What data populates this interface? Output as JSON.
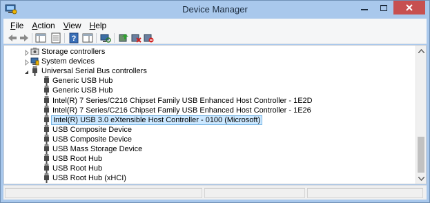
{
  "window": {
    "title": "Device Manager",
    "app_icon": "device-manager-icon"
  },
  "menu": [
    {
      "label": "File",
      "underline": "F",
      "rest": "ile"
    },
    {
      "label": "Action",
      "underline": "A",
      "rest": "ction"
    },
    {
      "label": "View",
      "underline": "V",
      "rest": "iew"
    },
    {
      "label": "Help",
      "underline": "H",
      "rest": "elp"
    }
  ],
  "toolbar": [
    {
      "icon": "back-arrow-icon"
    },
    {
      "icon": "forward-arrow-icon"
    },
    {
      "icon": "show-hide-console-tree-icon"
    },
    {
      "icon": "properties-icon"
    },
    {
      "icon": "help-icon"
    },
    {
      "icon": "show-hide-action-pane-icon"
    },
    {
      "icon": "scan-hardware-changes-icon"
    },
    {
      "icon": "update-driver-icon"
    },
    {
      "icon": "uninstall-device-icon"
    },
    {
      "icon": "disable-device-icon"
    }
  ],
  "tree": [
    {
      "label": "Storage controllers",
      "level": 1,
      "state": "collapsed",
      "icon": "storage-controller-icon"
    },
    {
      "label": "System devices",
      "level": 1,
      "state": "collapsed",
      "icon": "system-devices-icon"
    },
    {
      "label": "Universal Serial Bus controllers",
      "level": 1,
      "state": "expanded",
      "icon": "usb-icon"
    },
    {
      "label": "Generic USB Hub",
      "level": 2,
      "icon": "usb-icon"
    },
    {
      "label": "Generic USB Hub",
      "level": 2,
      "icon": "usb-icon"
    },
    {
      "label": "Intel(R) 7 Series/C216 Chipset Family USB Enhanced Host Controller - 1E2D",
      "level": 2,
      "icon": "usb-icon"
    },
    {
      "label": "Intel(R) 7 Series/C216 Chipset Family USB Enhanced Host Controller - 1E26",
      "level": 2,
      "icon": "usb-icon"
    },
    {
      "label": "Intel(R) USB 3.0 eXtensible Host Controller - 0100 (Microsoft)",
      "level": 2,
      "icon": "usb-icon",
      "selected": true
    },
    {
      "label": "USB Composite Device",
      "level": 2,
      "icon": "usb-icon"
    },
    {
      "label": "USB Composite Device",
      "level": 2,
      "icon": "usb-icon"
    },
    {
      "label": "USB Mass Storage Device",
      "level": 2,
      "icon": "usb-icon"
    },
    {
      "label": "USB Root Hub",
      "level": 2,
      "icon": "usb-icon"
    },
    {
      "label": "USB Root Hub",
      "level": 2,
      "icon": "usb-icon"
    },
    {
      "label": "USB Root Hub (xHCI)",
      "level": 2,
      "icon": "usb-icon"
    }
  ],
  "colors": {
    "title_bar": "#a9c8ec",
    "close_button": "#c75050",
    "selection_fill": "#cce8ff",
    "selection_border": "#7ab8e6"
  }
}
